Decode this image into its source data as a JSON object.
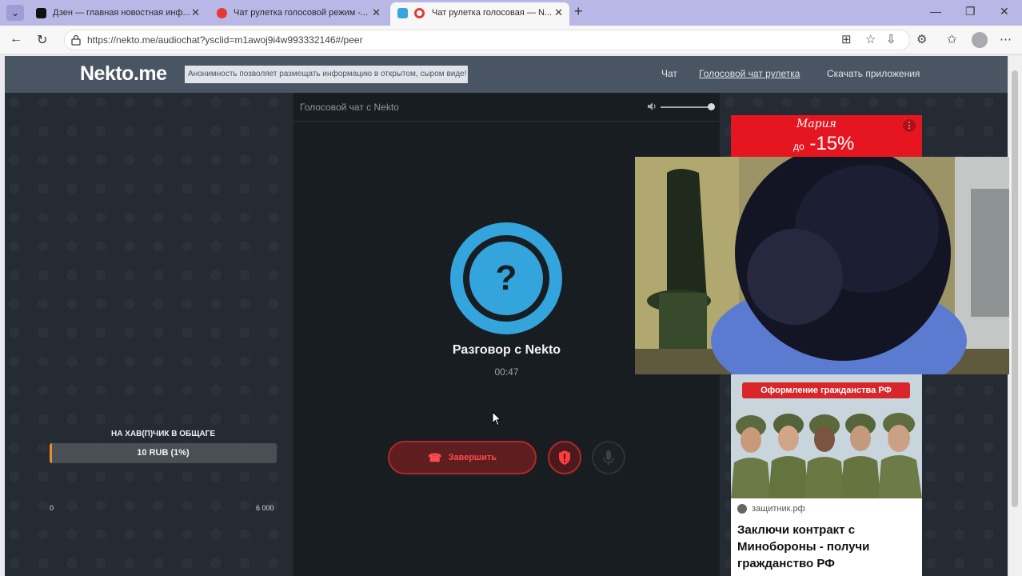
{
  "browser": {
    "tabs": [
      {
        "title": "Дзен — главная новостная инф..."
      },
      {
        "title": "Чат рулетка голосовой режим -..."
      },
      {
        "title": "Чат рулетка голосовая — N..."
      }
    ],
    "url": "https://nekto.me/audiochat?ysclid=m1awoj9i4w993332146#/peer"
  },
  "site": {
    "logo": "Nekto.me",
    "notice": "Анонимность позволяет размещать информацию в открытом, сыром виде!",
    "nav": [
      "Чат",
      "Голосовой чат рулетка",
      "Скачать приложения"
    ]
  },
  "donation": {
    "title": "НА ХАВ(П)ЧИК В ОБЩАГЕ",
    "value_text": "10 RUB (1%)",
    "progress_percent": 1,
    "min": "0",
    "max": "6 000",
    "colors": {
      "fill": "#e98c2d",
      "track": "#4a4f55"
    }
  },
  "chat": {
    "title": "Голосовой чат с Nekto",
    "avatar_symbol": "?",
    "status": "Разговор с Nekto",
    "timer": "00:47",
    "end_button": "Завершить",
    "volume_level_percent": 100,
    "colors": {
      "accent": "#34a4dd",
      "danger": "#b3262a"
    }
  },
  "ads": {
    "top": {
      "brand": "Мария",
      "discount_prefix": "до",
      "discount": "-15%"
    },
    "bottom": {
      "badge": "Оформление гражданства РФ",
      "source": "защитник.рф",
      "headline": "Заключи контракт с Минобороны - получи гражданство РФ"
    }
  }
}
